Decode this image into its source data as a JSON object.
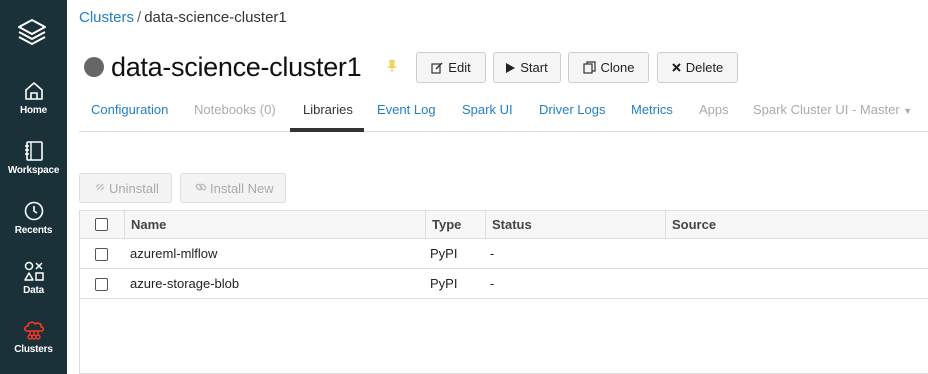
{
  "sidebar": {
    "items": [
      {
        "label": "Home",
        "icon": "home-icon"
      },
      {
        "label": "Workspace",
        "icon": "workspace-icon"
      },
      {
        "label": "Recents",
        "icon": "clock-icon"
      },
      {
        "label": "Data",
        "icon": "data-icon"
      },
      {
        "label": "Clusters",
        "icon": "cluster-icon",
        "active": true
      }
    ],
    "colors": {
      "background": "#1b3139",
      "active_accent": "#ff3621"
    }
  },
  "breadcrumb": {
    "parent": "Clusters",
    "separator": "/",
    "current": "data-science-cluster1"
  },
  "header": {
    "title": "data-science-cluster1",
    "status_color": "#666666",
    "pin_color": "#f2d45c",
    "buttons": {
      "edit": "Edit",
      "start": "Start",
      "clone": "Clone",
      "delete": "Delete"
    }
  },
  "tabs": [
    {
      "label": "Configuration",
      "state": "link"
    },
    {
      "label": "Notebooks (0)",
      "state": "disabled"
    },
    {
      "label": "Libraries",
      "state": "active"
    },
    {
      "label": "Event Log",
      "state": "link"
    },
    {
      "label": "Spark UI",
      "state": "link"
    },
    {
      "label": "Driver Logs",
      "state": "link"
    },
    {
      "label": "Metrics",
      "state": "link"
    },
    {
      "label": "Apps",
      "state": "disabled"
    },
    {
      "label": "Spark Cluster UI - Master",
      "state": "disabled"
    }
  ],
  "actions": {
    "uninstall": "Uninstall",
    "install_new": "Install New"
  },
  "table": {
    "columns": [
      "Name",
      "Type",
      "Status",
      "Source"
    ],
    "rows": [
      {
        "name": "azureml-mlflow",
        "type": "PyPI",
        "status": "-",
        "source": ""
      },
      {
        "name": "azure-storage-blob",
        "type": "PyPI",
        "status": "-",
        "source": ""
      }
    ]
  }
}
